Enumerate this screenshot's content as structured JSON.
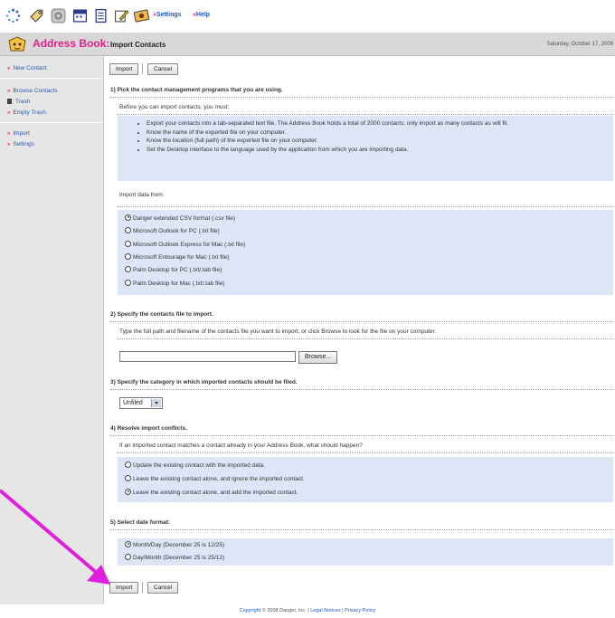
{
  "toolbar": {
    "icons": [
      "loading-icon",
      "tag-icon",
      "settings-gear-icon",
      "calendar-icon",
      "notes-icon",
      "edit-pencil-icon",
      "photo-icon"
    ],
    "settings_label": "Settings",
    "help_label": "Help"
  },
  "header": {
    "app_title": "Address Book:",
    "page_title": "Import Contacts",
    "date": "Saturday, October 17, 2009"
  },
  "sidebar": {
    "items": [
      {
        "label": "New Contact"
      },
      {
        "label": "Browse Contacts"
      },
      {
        "label": "Trash"
      },
      {
        "label": "Empty Trash"
      },
      {
        "label": "Import"
      },
      {
        "label": "Settings"
      }
    ]
  },
  "buttons": {
    "import": "Import",
    "cancel": "Cancel",
    "browse": "Browse..."
  },
  "section1": {
    "title": "1) Pick the contact management programs that you are using.",
    "subtitle": "Before you can import contacts, you must:",
    "bullets": [
      "Export your contacts into a tab-separated text file. The Address Book holds a total of 2000 contacts; only import as many contacts as will fit.",
      "Know the name of the exported file on your computer.",
      "Know the location (full path) of the exported file on your computer.",
      "Set the Desktop interface to the language used by the application from which you are importing data."
    ],
    "import_from_label": "Import data from:",
    "options": [
      "Danger extended CSV format (.csv file)",
      "Microsoft Outlook for PC (.txt file)",
      "Microsoft Outlook Express for Mac (.txt file)",
      "Microsoft Entourage for Mac (.txt file)",
      "Palm Desktop for PC (.txt/.tab file)",
      "Palm Desktop for Mac (.txt/.tab file)"
    ],
    "selected_index": 0
  },
  "section2": {
    "title": "2) Specify the contacts file to import.",
    "subtitle": "Type the full path and filename of the contacts file you want to import, or click Browse to look for the file on your computer.",
    "file_value": ""
  },
  "section3": {
    "title": "3) Specify the category in which imported contacts should be filed.",
    "category": "Unfiled"
  },
  "section4": {
    "title": "4) Resolve import conflicts.",
    "subtitle": "If an imported contact matches a contact already in your Address Book, what should happen?",
    "options": [
      "Update the existing contact with the imported data.",
      "Leave the existing contact alone, and ignore the imported contact.",
      "Leave the existing contact alone, and add the imported contact."
    ],
    "selected_index": 2
  },
  "section5": {
    "title": "5) Select date format:",
    "options": [
      "Month/Day (December 25 is 12/25)",
      "Day/Month (December 25 is 25/12)"
    ],
    "selected_index": 0
  },
  "footer": {
    "copyright": "Copyright",
    "company": " © 2008 Danger, Inc. | ",
    "legal": "Legal Notices",
    "sep": " | ",
    "privacy": "Privacy Policy"
  },
  "colors": {
    "accent": "#e0228a",
    "link": "#1a55c8",
    "panel": "#dce6f7",
    "sidebar": "#e6e6e6"
  }
}
